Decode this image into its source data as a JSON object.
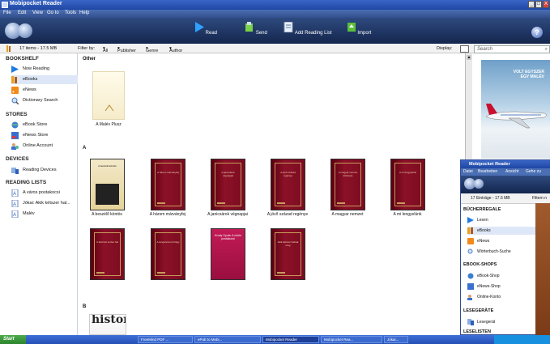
{
  "window": {
    "title": "Mobipocket Reader",
    "menu": [
      "File",
      "Edit",
      "View",
      "Go to",
      "Tools",
      "Help"
    ],
    "controls": [
      "_",
      "□",
      "X"
    ]
  },
  "toolbar": {
    "read": "Read",
    "send": "Send",
    "add_reading_list": "Add Reading List",
    "import": "Import",
    "help": "?"
  },
  "filterbar": {
    "count": "17 items - 17.5 MB",
    "filter_by": "Filter by:",
    "all": "All",
    "publisher": "Publisher",
    "genre": "Genre",
    "author": "Author",
    "display": "Display:",
    "search_placeholder": "Search"
  },
  "sidebar": {
    "bookshelf": "BOOKSHELF",
    "bookshelf_items": [
      "Now Reading",
      "eBooks",
      "eNews",
      "Dictionary Search"
    ],
    "stores": "STORES",
    "stores_items": [
      "eBook Store",
      "eNews Store",
      "Online Account"
    ],
    "devices": "DEVICES",
    "devices_items": [
      "Reading Devices"
    ],
    "reading_lists": "READING LISTS",
    "reading_lists_items": [
      "A város postakocsi",
      "Jókai: Akik kétszer hal...",
      "Malév"
    ]
  },
  "main": {
    "group_other": "Other",
    "other_caption": "A Malév Plusz",
    "group_a": "A",
    "group_b": "B",
    "a_books": [
      {
        "caption": "A beszélő köntös",
        "cover_title": "A beszélő köntös"
      },
      {
        "caption": "A három márványfej",
        "cover_title": "A három márványfej"
      },
      {
        "caption": "A janicsárok végnapjai",
        "cover_title": "A janicsárok végnapjai"
      },
      {
        "caption": "A jövő század regénye",
        "cover_title": "A jövő század regénye"
      },
      {
        "caption": "A magyar nemzet",
        "cover_title": "A magyar nemzet története"
      },
      {
        "caption": "A mi lengyelünk",
        "cover_title": "A mi lengyelünk"
      }
    ],
    "a_books_row2": [
      {
        "cover_title": "A kőszívű ember fiai"
      },
      {
        "cover_title": "A tengerszemű hölgy"
      },
      {
        "cover_title": "Krúdy Gyula: A vörös postakocsi"
      },
      {
        "cover_title": "Akik kétszer halnak meg"
      }
    ],
    "b_book": "history"
  },
  "ad": {
    "line1": "VOLT EGYSZER",
    "line2": "EGY MALÉV"
  },
  "german_window": {
    "title": "Mobipocket Reader",
    "menu": [
      "Datei",
      "Bearbeiten",
      "Ansicht",
      "Gehe zu"
    ],
    "count": "17 Einträge - 17.5 MB",
    "filter": "Filtern n",
    "bookshelf": "BÜCHERREGALE",
    "bookshelf_items": [
      "Lesen",
      "eBooks",
      "eNews",
      "Wörterbuch-Suche"
    ],
    "shops": "EBOOK-SHOPS",
    "shops_items": [
      "eBook-Shop",
      "eNews-Shop",
      "Online-Konto"
    ],
    "devices": "LESEGERÄTE",
    "devices_items": [
      "Lesegerät"
    ],
    "lists": "LESELISTEN"
  },
  "taskbar": {
    "start": "Start",
    "tasks": [
      "FreeMind PDF ...",
      "ePub to Mobi...",
      "Mobipocket Reader",
      "Mobipocket Rea...",
      "Jókai..."
    ],
    "clock": ""
  },
  "colors": {
    "title_blue": "#1f47a3",
    "toolbar_dark": "#14264d",
    "book_red": "#8c1128",
    "selection": "#dde7f7"
  }
}
